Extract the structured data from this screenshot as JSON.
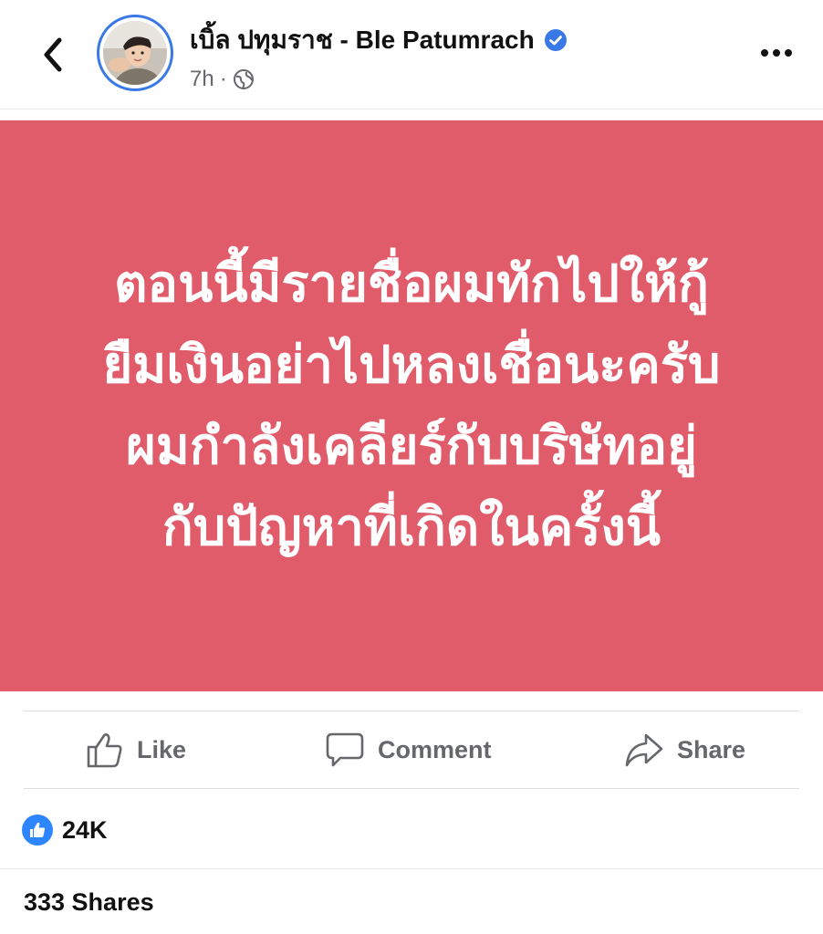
{
  "header": {
    "author_name": "เบิ้ล ปทุมราช - Ble Patumrach",
    "time": "7h",
    "separator": "·",
    "privacy_icon": "globe-icon",
    "back_icon": "chevron-left-icon",
    "more_icon": "more-horizontal-icon",
    "verified_icon": "verified-badge-icon"
  },
  "post": {
    "background_color": "#e15c6b",
    "text": "ตอนนี้มีรายชื่อผมทักไปให้กู้\nยืมเงินอย่าไปหลงเชื่อนะครับ\nผมกำลังเคลียร์กับบริษัทอยู่\nกับปัญหาที่เกิดในครั้งนี้"
  },
  "actions": {
    "like_label": "Like",
    "comment_label": "Comment",
    "share_label": "Share"
  },
  "stats": {
    "reaction_count": "24K",
    "shares_text": "333 Shares"
  },
  "colors": {
    "accent": "#2d86ff",
    "verified": "#3b78e7",
    "muted_text": "#65676b"
  }
}
